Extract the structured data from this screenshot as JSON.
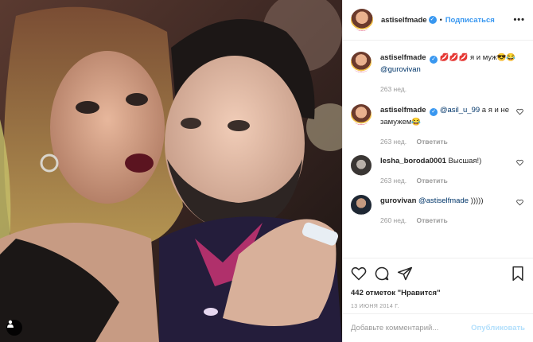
{
  "post": {
    "author": "astiselfmade",
    "follow_label": "Подписаться",
    "more_label": "•••",
    "separator": "•"
  },
  "comments": [
    {
      "user": "astiselfmade",
      "verified": true,
      "text_before": " 💋💋💋 я и муж😎😂 ",
      "mention": "@gurovivan",
      "text_after": "",
      "time": "263 нед.",
      "reply": ""
    },
    {
      "user": "astiselfmade",
      "verified": true,
      "text_before": " ",
      "mention": "@asil_u_99",
      "text_after": " а я и не замужем😂",
      "time": "263 нед.",
      "reply": "Ответить"
    },
    {
      "user": "lesha_boroda0001",
      "verified": false,
      "text_before": " Высшая!)",
      "mention": "",
      "text_after": "",
      "time": "263 нед.",
      "reply": "Ответить"
    },
    {
      "user": "gurovivan",
      "verified": false,
      "text_before": " ",
      "mention": "@astiselfmade",
      "text_after": " )))))",
      "time": "260 нед.",
      "reply": "Ответить"
    }
  ],
  "likes_text": "442 отметок \"Нравится\"",
  "date_text": "13 ИЮНЯ 2014 Г.",
  "add_comment": {
    "placeholder": "Добавьте комментарий...",
    "publish_label": "Опубликовать"
  },
  "icons": {
    "like": "heart-icon",
    "comment": "comment-icon",
    "share": "share-icon",
    "save": "bookmark-icon",
    "user_tag": "user-tag-icon",
    "verified": "verified-badge-icon"
  },
  "colors": {
    "accent": "#3897f0",
    "mention": "#003569",
    "muted": "#999999",
    "publish_disabled": "#b2dffc"
  }
}
